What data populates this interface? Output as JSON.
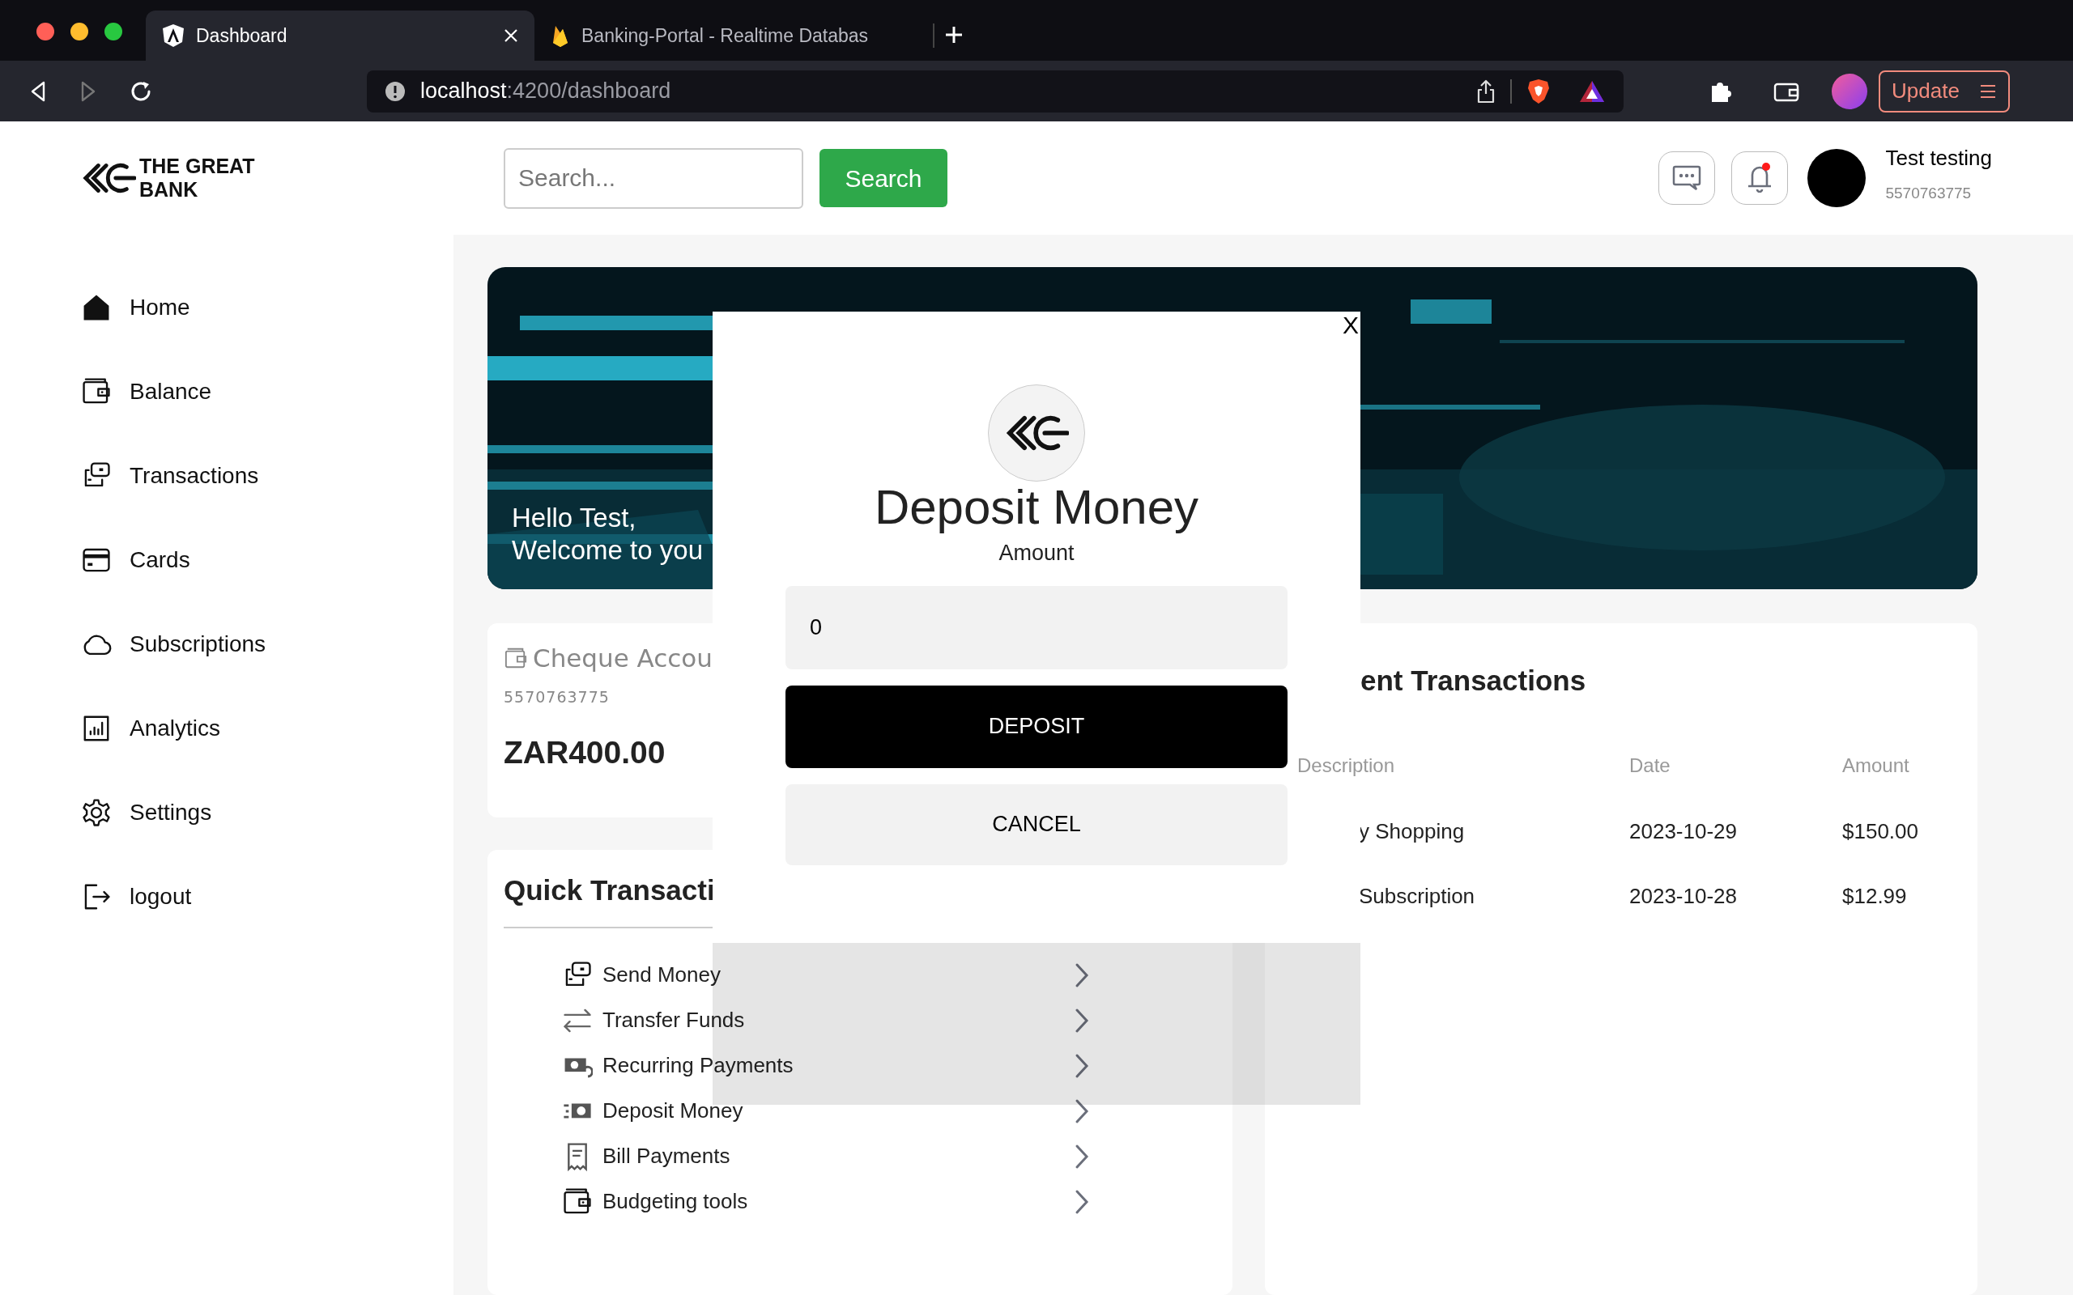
{
  "browser": {
    "tabs": [
      {
        "title": "Dashboard",
        "selected": true
      },
      {
        "title": "Banking-Portal - Realtime Databas",
        "selected": false
      }
    ],
    "address": {
      "host": "localhost",
      "rest": ":4200/dashboard"
    },
    "update_button": "Update"
  },
  "brand": {
    "line1": "THE GREAT",
    "line2": "BANK"
  },
  "search": {
    "placeholder": "Search...",
    "button": "Search"
  },
  "user": {
    "name": "Test testing",
    "account": "5570763775",
    "has_notification": true
  },
  "sidebar": {
    "items": [
      {
        "label": "Home"
      },
      {
        "label": "Balance"
      },
      {
        "label": "Transactions"
      },
      {
        "label": "Cards"
      },
      {
        "label": "Subscriptions"
      },
      {
        "label": "Analytics"
      },
      {
        "label": "Settings"
      },
      {
        "label": "logout"
      }
    ]
  },
  "banner": {
    "line1": "Hello Test,",
    "line2": "Welcome to you"
  },
  "account_card": {
    "title": "Cheque Accou",
    "number": "5570763775",
    "balance": "ZAR400.00"
  },
  "quick_transactions": {
    "title": "Quick Transacti",
    "items": [
      {
        "label": "Send Money"
      },
      {
        "label": "Transfer Funds"
      },
      {
        "label": "Recurring Payments"
      },
      {
        "label": "Deposit Money"
      },
      {
        "label": "Bill Payments"
      },
      {
        "label": "Budgeting tools"
      }
    ]
  },
  "recent_transactions": {
    "title": "ent Transactions",
    "columns": [
      "Description",
      "Date",
      "Amount"
    ],
    "rows": [
      [
        "y Shopping",
        "2023-10-29",
        "$150.00"
      ],
      [
        "Subscription",
        "2023-10-28",
        "$12.99"
      ]
    ]
  },
  "modal": {
    "close": "X",
    "title": "Deposit Money",
    "label": "Amount",
    "value": "0",
    "primary": "DEPOSIT",
    "secondary": "CANCEL"
  }
}
